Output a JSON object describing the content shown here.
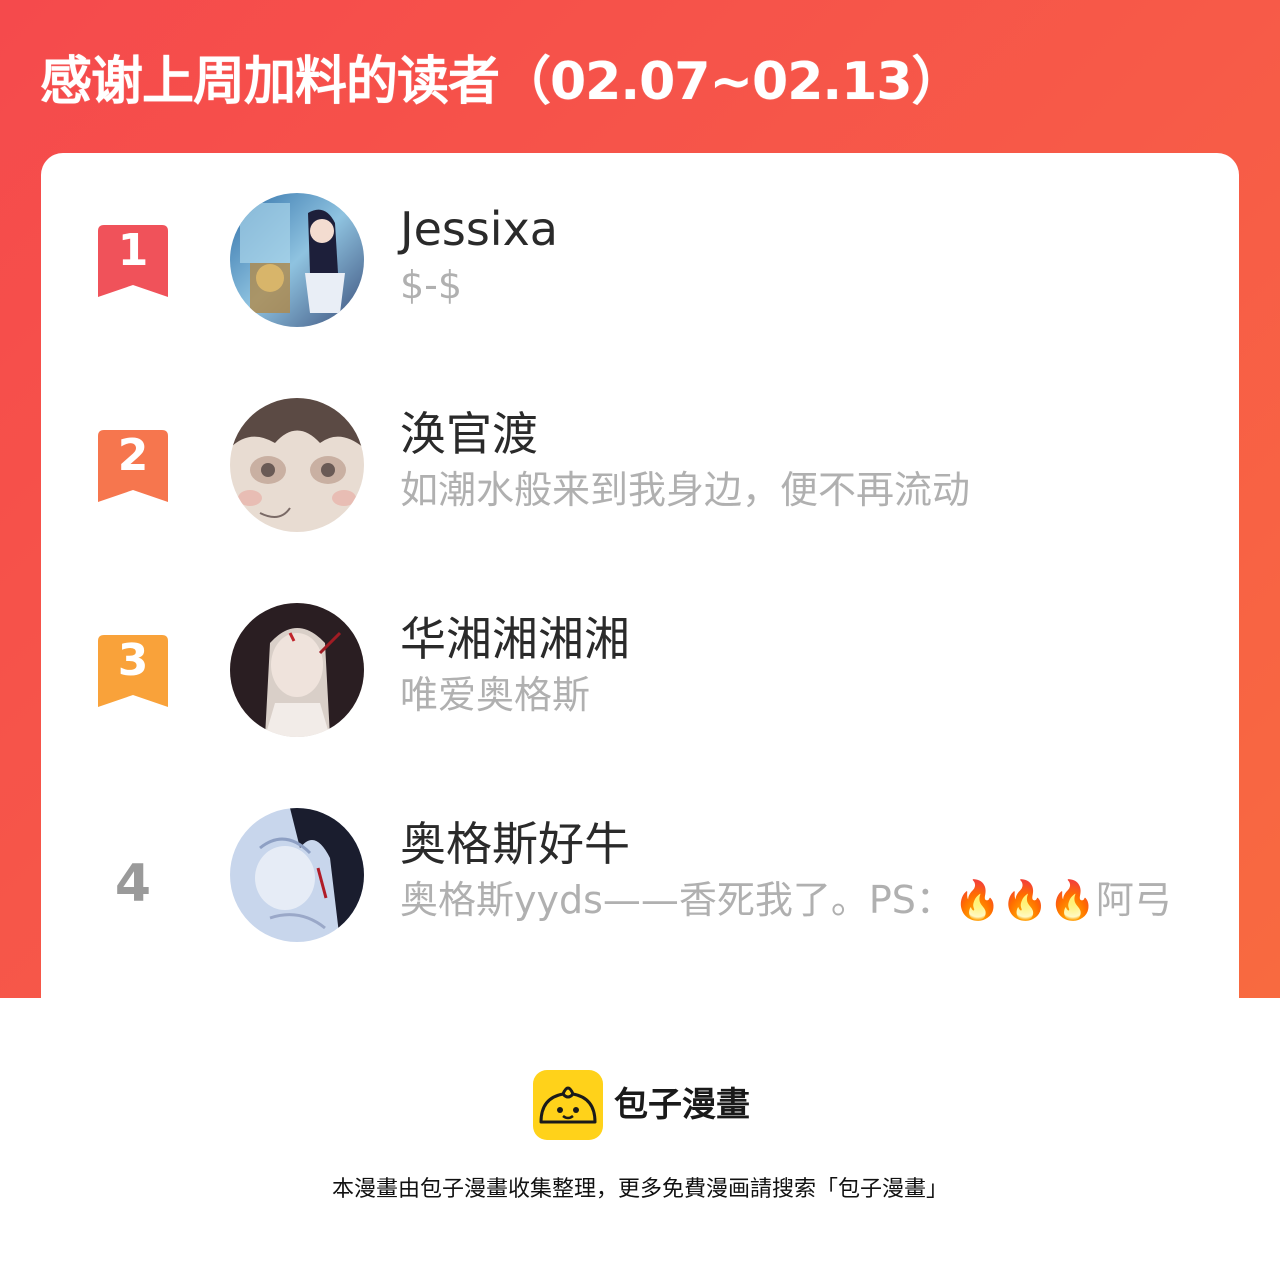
{
  "header": {
    "title": "感谢上周加料的读者（02.07~02.13）"
  },
  "readers": [
    {
      "rank": "1",
      "name": "Jessixa",
      "motto": "$-$",
      "badge_color": "#f0525a"
    },
    {
      "rank": "2",
      "name": "涣官渡",
      "motto": "如潮水般来到我身边，便不再流动",
      "badge_color": "#f6764e"
    },
    {
      "rank": "3",
      "name": "华湘湘湘湘",
      "motto": "唯爱奥格斯",
      "badge_color": "#f9a23a"
    },
    {
      "rank": "4",
      "name": "奥格斯好牛",
      "motto": "奥格斯yyds——香死我了。PS：🔥🔥🔥阿弓",
      "badge_color": "#9a9a9a"
    }
  ],
  "footer": {
    "brand": "包子漫畫",
    "note": "本漫畫由包子漫畫收集整理，更多免費漫画請搜索「包子漫畫」"
  },
  "colors": {
    "banner_start": "#f54a4c",
    "banner_end": "#f86a40",
    "logo_yellow": "#ffd21a"
  }
}
